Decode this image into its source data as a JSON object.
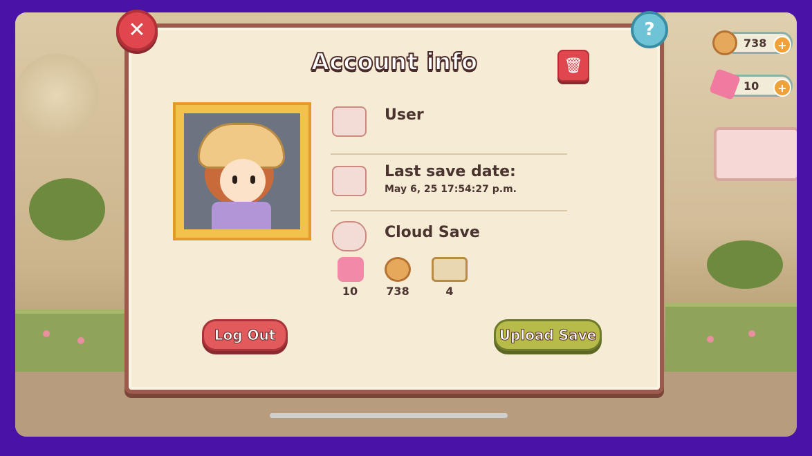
{
  "panel": {
    "title": "Account info",
    "close_symbol": "✕",
    "help_symbol": "?",
    "trash_symbol": "🗑"
  },
  "user": {
    "label": "User",
    "name": ""
  },
  "last_save": {
    "label": "Last save date:",
    "value": "May 6, 25  17:54:27 p.m."
  },
  "cloud_save": {
    "label": "Cloud Save",
    "stats": [
      {
        "icon": "gem-icon",
        "value": "10"
      },
      {
        "icon": "button-coin-icon",
        "value": "738"
      },
      {
        "icon": "map-icon",
        "value": "4"
      }
    ]
  },
  "buttons": {
    "logout": "Log Out",
    "upload": "Upload Save"
  },
  "hud": {
    "coins": "738",
    "gems": "10",
    "plus_symbol": "+"
  },
  "colors": {
    "frame": "#4a12a6",
    "panel": "#f6ecd6",
    "panel_border": "#9b5a4c",
    "red_button": "#e25a5c",
    "green_button": "#b7bb4a"
  }
}
